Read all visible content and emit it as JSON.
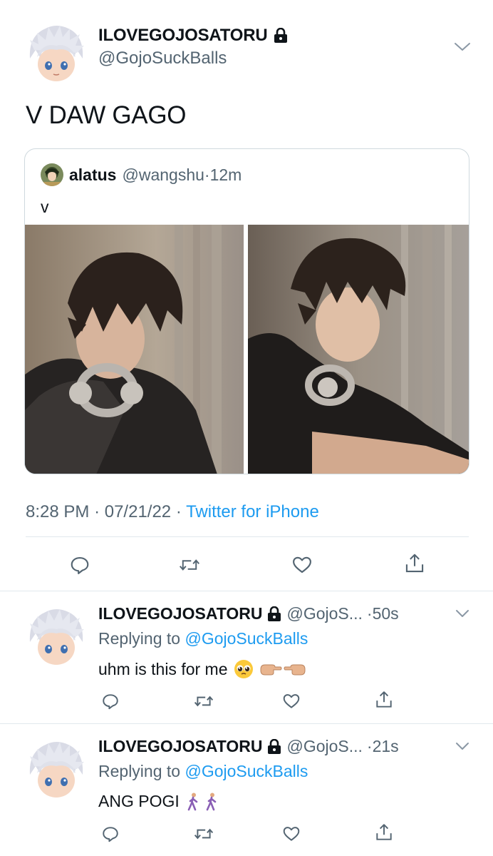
{
  "main_tweet": {
    "display_name": "ILOVEGOJOSATORU",
    "handle": "@GojoSuckBalls",
    "text": "V DAW GAGO",
    "time": "8:28 PM",
    "date": "07/21/22",
    "source": "Twitter for iPhone",
    "separator": "·"
  },
  "quoted_tweet": {
    "display_name": "alatus",
    "handle": "@wangshu",
    "time": "12m",
    "separator": "·",
    "text": "v"
  },
  "replies": [
    {
      "display_name": "ILOVEGOJOSATORU",
      "handle": "@GojoS...",
      "time": "·50s",
      "replying_prefix": "Replying to",
      "replying_to": "@GojoSuckBalls",
      "text": "uhm is this for me",
      "emojis": [
        "pleading-face-emoji",
        "pointing-fingers-emoji"
      ]
    },
    {
      "display_name": "ILOVEGOJOSATORU",
      "handle": "@GojoS...",
      "time": "·21s",
      "replying_prefix": "Replying to",
      "replying_to": "@GojoSuckBalls",
      "text": "ANG POGI",
      "emojis": [
        "walking-person-emoji",
        "walking-person-emoji"
      ]
    }
  ],
  "icons": {
    "reply": "reply-icon",
    "retweet": "retweet-icon",
    "like": "heart-icon",
    "share": "share-icon",
    "more": "chevron-down-icon",
    "lock": "lock-icon"
  },
  "colors": {
    "accent": "#1d9bf0",
    "secondary_text": "#536471",
    "divider": "#e1e8ed"
  }
}
